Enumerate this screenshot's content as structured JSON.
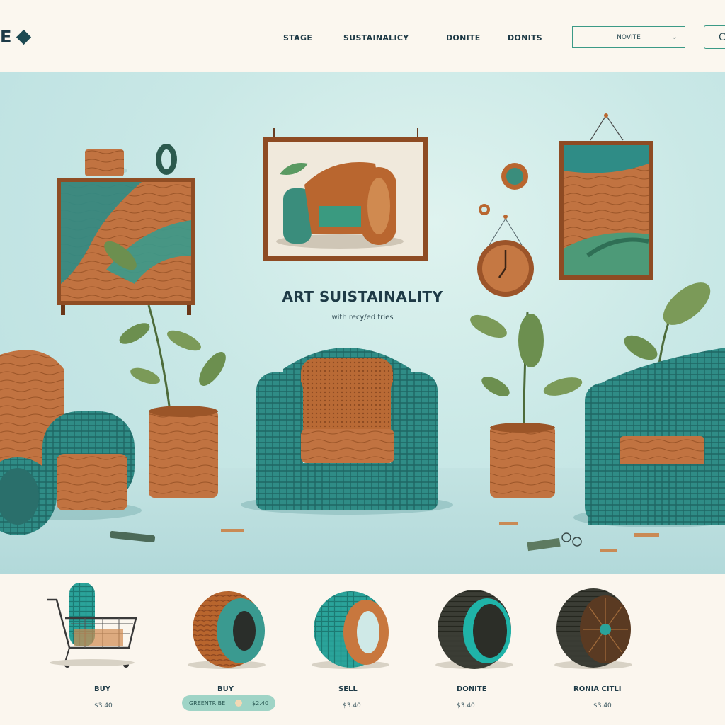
{
  "header": {
    "logo_text": "E",
    "nav": [
      "STAGE",
      "SUSTAINALICY",
      "DONITE",
      "DONITS"
    ],
    "dropdown_value": "NOVITE",
    "button_label": "C"
  },
  "hero": {
    "title": "ART SUISTAINALITY",
    "subtitle": "with recy/ed tries"
  },
  "products": [
    {
      "label": "BUY",
      "price": "$3.40"
    },
    {
      "label": "BUY",
      "price": "$2.40",
      "pill_text": "GREENTRIBE"
    },
    {
      "label": "SELL",
      "price": "$3.40"
    },
    {
      "label": "DONITE",
      "price": "$3.40"
    },
    {
      "label": "RONIA CITLI",
      "price": "$3.40"
    }
  ],
  "colors": {
    "accent": "#3b9a86",
    "teal": "#2f8c86",
    "rubber": "#c0703a",
    "wood": "#b86a37",
    "navy": "#1e3a46",
    "background": "#fbf6ee"
  }
}
